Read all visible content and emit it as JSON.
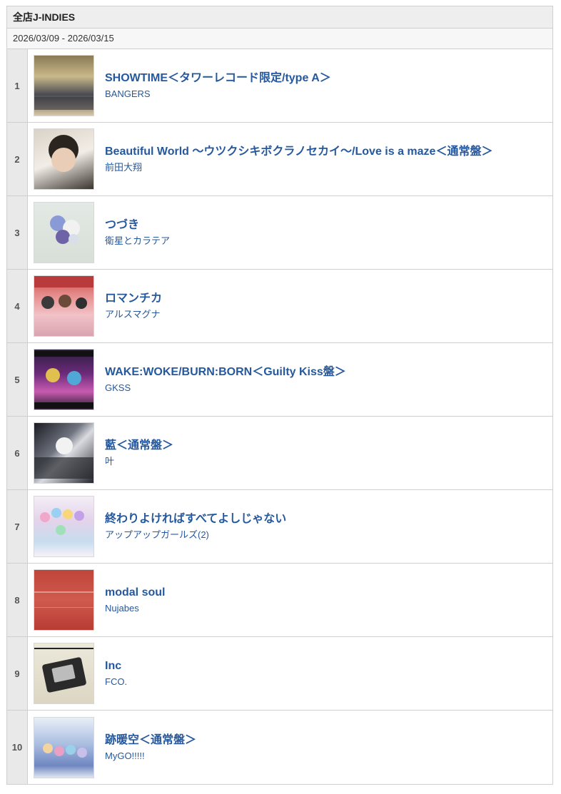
{
  "panel": {
    "heading": "全店J-INDIES",
    "period": "2026/03/09 - 2026/03/15"
  },
  "ranking": [
    {
      "rank": "1",
      "title": "SHOWTIME＜タワーレコード限定/type A＞",
      "artist": "BANGERS"
    },
    {
      "rank": "2",
      "title": "Beautiful World 〜ウツクシキボクラノセカイ〜/Love is a maze＜通常盤＞",
      "artist": "前田大翔"
    },
    {
      "rank": "3",
      "title": "つづき",
      "artist": "衛星とカラテア"
    },
    {
      "rank": "4",
      "title": "ロマンチカ",
      "artist": "アルスマグナ"
    },
    {
      "rank": "5",
      "title": "WAKE:WOKE/BURN:BORN＜Guilty Kiss盤＞",
      "artist": "GKSS"
    },
    {
      "rank": "6",
      "title": "藍＜通常盤＞",
      "artist": "叶"
    },
    {
      "rank": "7",
      "title": "終わりよければすべてよしじゃない",
      "artist": "アップアップガールズ(2)"
    },
    {
      "rank": "8",
      "title": "modal soul",
      "artist": "Nujabes"
    },
    {
      "rank": "9",
      "title": "Inc",
      "artist": "FCO."
    },
    {
      "rank": "10",
      "title": "跡暖空＜通常盤＞",
      "artist": "MyGO!!!!!"
    }
  ],
  "colors": {
    "link": "#25589c",
    "rank_cell": "#e9e9e9",
    "header_bg": "#eeeeee",
    "border": "#cfcfcf"
  }
}
